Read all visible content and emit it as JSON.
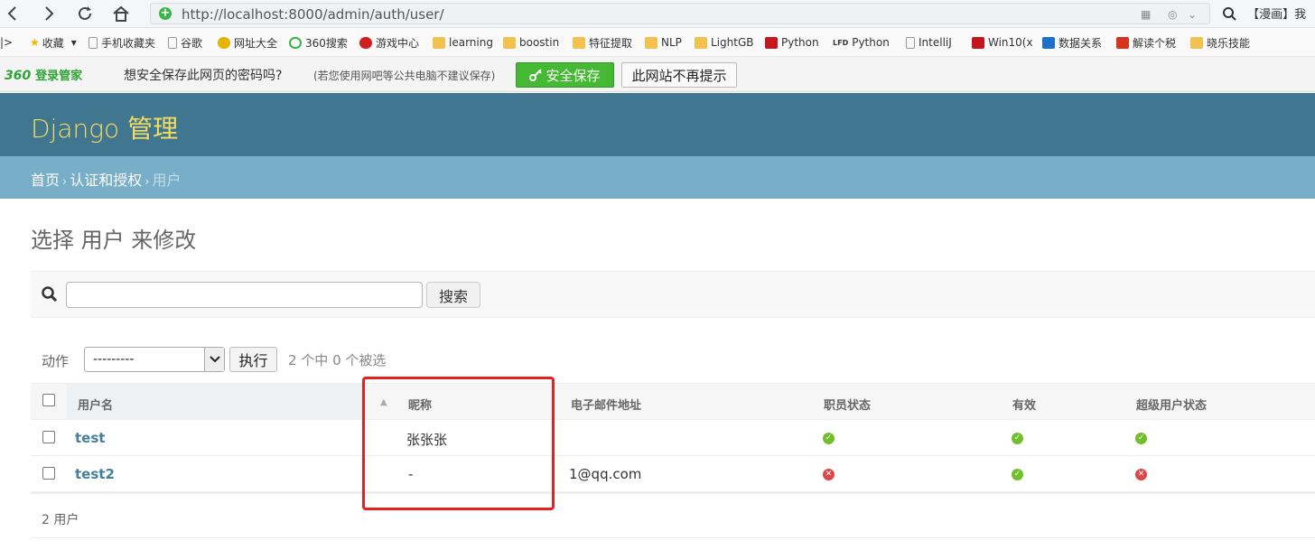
{
  "browser": {
    "url": "http://localhost:8000/admin/auth/user/",
    "search_text": "【漫画】我",
    "bookmarks": [
      "收藏",
      "手机收藏夹",
      "谷歌",
      "网址大全",
      "360搜索",
      "游戏中心",
      "learning",
      "boostin",
      "特征提取",
      "NLP",
      "LightGB",
      "Python",
      "Python",
      "IntelliJ",
      "Win10(x",
      "数据关系",
      "解读个税",
      "晓乐技能"
    ]
  },
  "password_bar": {
    "brand": "360",
    "brand_label": "登录管家",
    "question": "想安全保存此网页的密码吗?",
    "tip": "(若您使用网吧等公共电脑不建议保存)",
    "save_label": "安全保存",
    "never_label": "此网站不再提示"
  },
  "admin": {
    "branding": "Django 管理",
    "breadcrumbs": [
      "首页",
      "认证和授权",
      "用户"
    ],
    "page_title": "选择 用户 来修改",
    "search_input_value": "",
    "search_button": "搜索",
    "action_label": "动作",
    "action_select_value": "---------",
    "go_button": "执行",
    "action_counter": "2 个中 0 个被选",
    "columns": [
      "用户名",
      "昵称",
      "电子邮件地址",
      "职员状态",
      "有效",
      "超级用户状态"
    ],
    "rows": [
      {
        "username": "test",
        "nickname": "张张张",
        "email": "",
        "is_staff": true,
        "is_active": true,
        "is_superuser": true
      },
      {
        "username": "test2",
        "nickname": "-",
        "email": "1@qq.com",
        "is_staff": false,
        "is_active": true,
        "is_superuser": false
      }
    ],
    "result_count": "2 用户"
  },
  "colors": {
    "header_bg": "#417690",
    "breadcrumb_bg": "#79aec8",
    "branding": "#f5dd5d",
    "link": "#447e9b",
    "highlight": "#e8201b"
  }
}
